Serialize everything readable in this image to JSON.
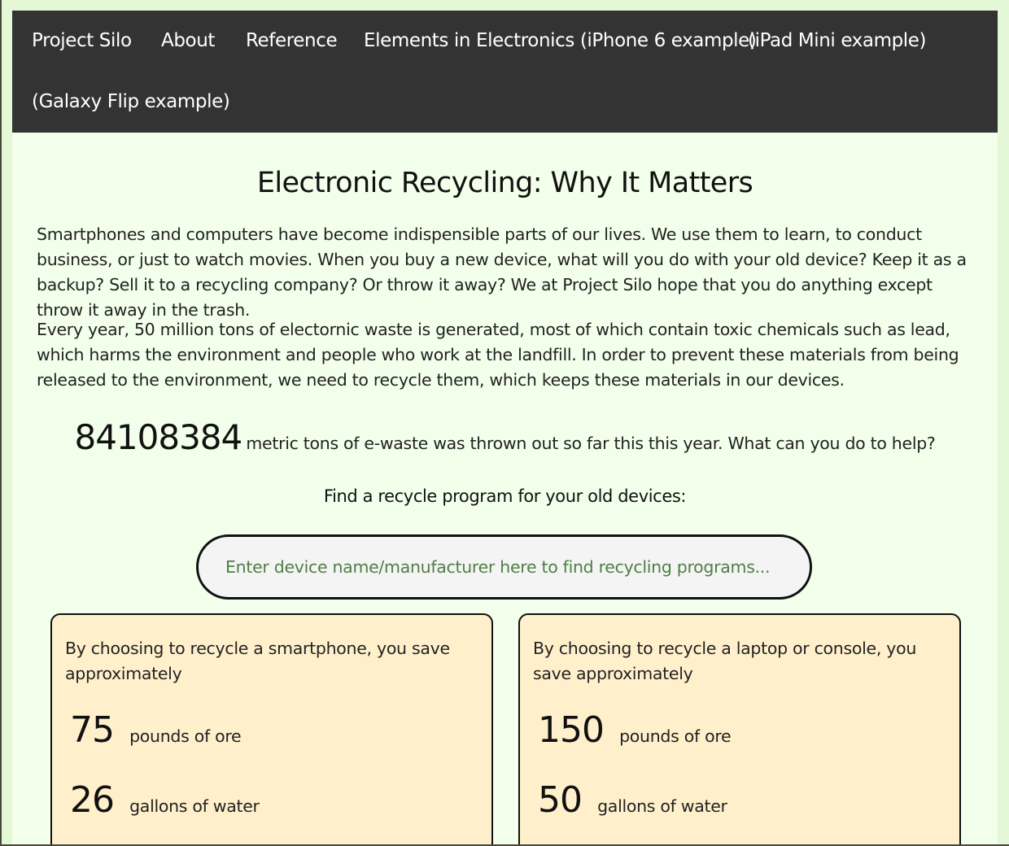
{
  "nav": {
    "items": [
      "Project Silo",
      "About",
      "Reference",
      "Elements in Electronics (iPhone 6 example)",
      "(iPad Mini example)",
      "(Galaxy Flip example)"
    ]
  },
  "main": {
    "title": "Electronic Recycling: Why It Matters",
    "paragraphs": [
      "Smartphones and computers have become indispensible parts of our lives. We use them to learn, to conduct business, or just to watch movies. When you buy a new device, what will you do with your old device? Keep it as a backup? Sell it to a recycling company? Or throw it away? We at Project Silo hope that you do anything except throw it away in the trash.",
      "Every year, 50 million tons of electornic waste is generated, most of which contain toxic chemicals such as lead, which harms the environment and people who work at the landfill. In order to prevent these materials from being released to the environment, we need to recycle them, which keeps these materials in our devices."
    ],
    "counter": {
      "value": "84108384",
      "text": "metric tons of e-waste was thrown out so far this this year. What can you do to help?"
    },
    "find_label": "Find a recycle program for your old devices:",
    "search": {
      "placeholder": "Enter device name/manufacturer here to find recycling programs...",
      "value": ""
    }
  },
  "cards": [
    {
      "intro": "By choosing to recycle a smartphone, you save approximately",
      "stats": [
        {
          "value": "75",
          "unit": "pounds of ore"
        },
        {
          "value": "26",
          "unit": "gallons of water"
        }
      ]
    },
    {
      "intro": "By choosing to recycle a laptop or console, you save approximately",
      "stats": [
        {
          "value": "150",
          "unit": "pounds of ore"
        },
        {
          "value": "50",
          "unit": "gallons of water"
        }
      ]
    }
  ],
  "colors": {
    "page_background": "#e4f7d6",
    "nav_background": "#333333",
    "content_background": "#f2ffea",
    "card_background": "#fff0cb",
    "placeholder_text": "#4f7f44"
  }
}
